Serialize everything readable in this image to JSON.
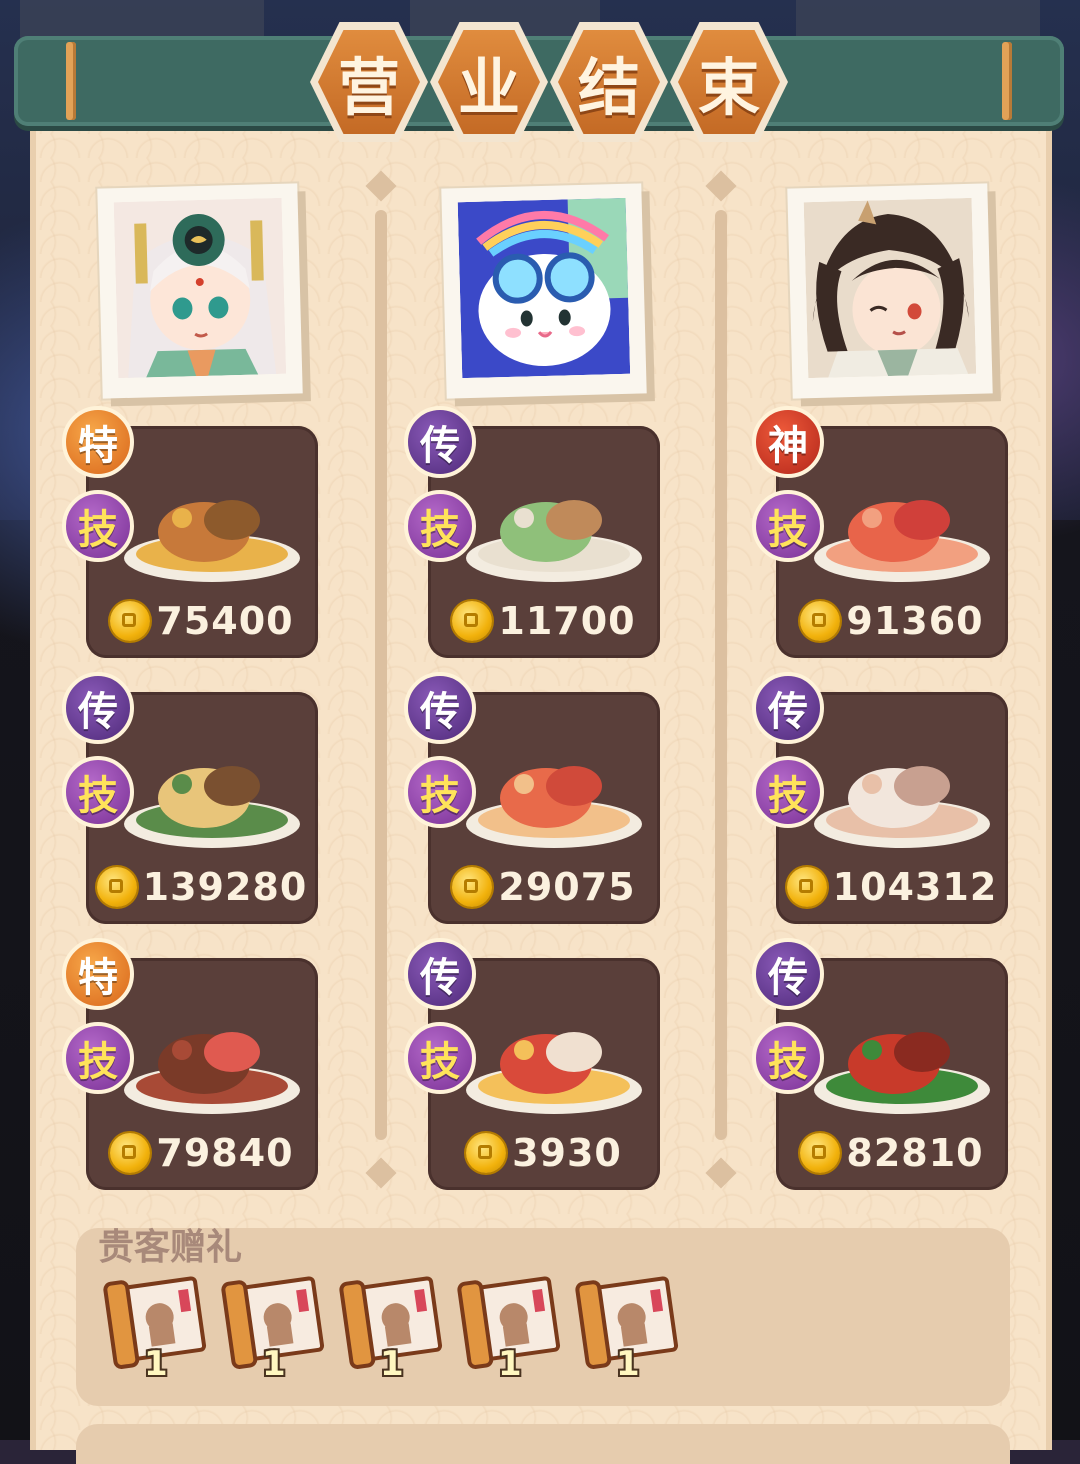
{
  "title": {
    "chars": [
      "营",
      "业",
      "结",
      "束"
    ]
  },
  "columns": [
    {
      "dishes": [
        {
          "badge": "特",
          "badge_color": "orange",
          "skill": "技",
          "price": "75400"
        },
        {
          "badge": "传",
          "badge_color": "purple",
          "skill": "技",
          "price": "139280"
        },
        {
          "badge": "特",
          "badge_color": "orange",
          "skill": "技",
          "price": "79840"
        }
      ]
    },
    {
      "dishes": [
        {
          "badge": "传",
          "badge_color": "purple",
          "skill": "技",
          "price": "11700"
        },
        {
          "badge": "传",
          "badge_color": "purple",
          "skill": "技",
          "price": "29075"
        },
        {
          "badge": "传",
          "badge_color": "purple",
          "skill": "技",
          "price": "3930"
        }
      ]
    },
    {
      "dishes": [
        {
          "badge": "神",
          "badge_color": "red",
          "skill": "技",
          "price": "91360"
        },
        {
          "badge": "传",
          "badge_color": "purple",
          "skill": "技",
          "price": "104312"
        },
        {
          "badge": "传",
          "badge_color": "purple",
          "skill": "技",
          "price": "82810"
        }
      ]
    }
  ],
  "gifts": {
    "title": "贵客赠礼",
    "items": [
      {
        "icon": "scroll-ticket-icon",
        "count": "1"
      },
      {
        "icon": "scroll-ticket-icon",
        "count": "1"
      },
      {
        "icon": "scroll-ticket-icon",
        "count": "1"
      },
      {
        "icon": "scroll-ticket-icon",
        "count": "1"
      },
      {
        "icon": "scroll-ticket-icon",
        "count": "1"
      }
    ]
  },
  "colors": {
    "panel": "#f7e3c8",
    "title_bar": "#3e6a62",
    "card": "#5a3f3a",
    "hex": "#d9782f"
  }
}
